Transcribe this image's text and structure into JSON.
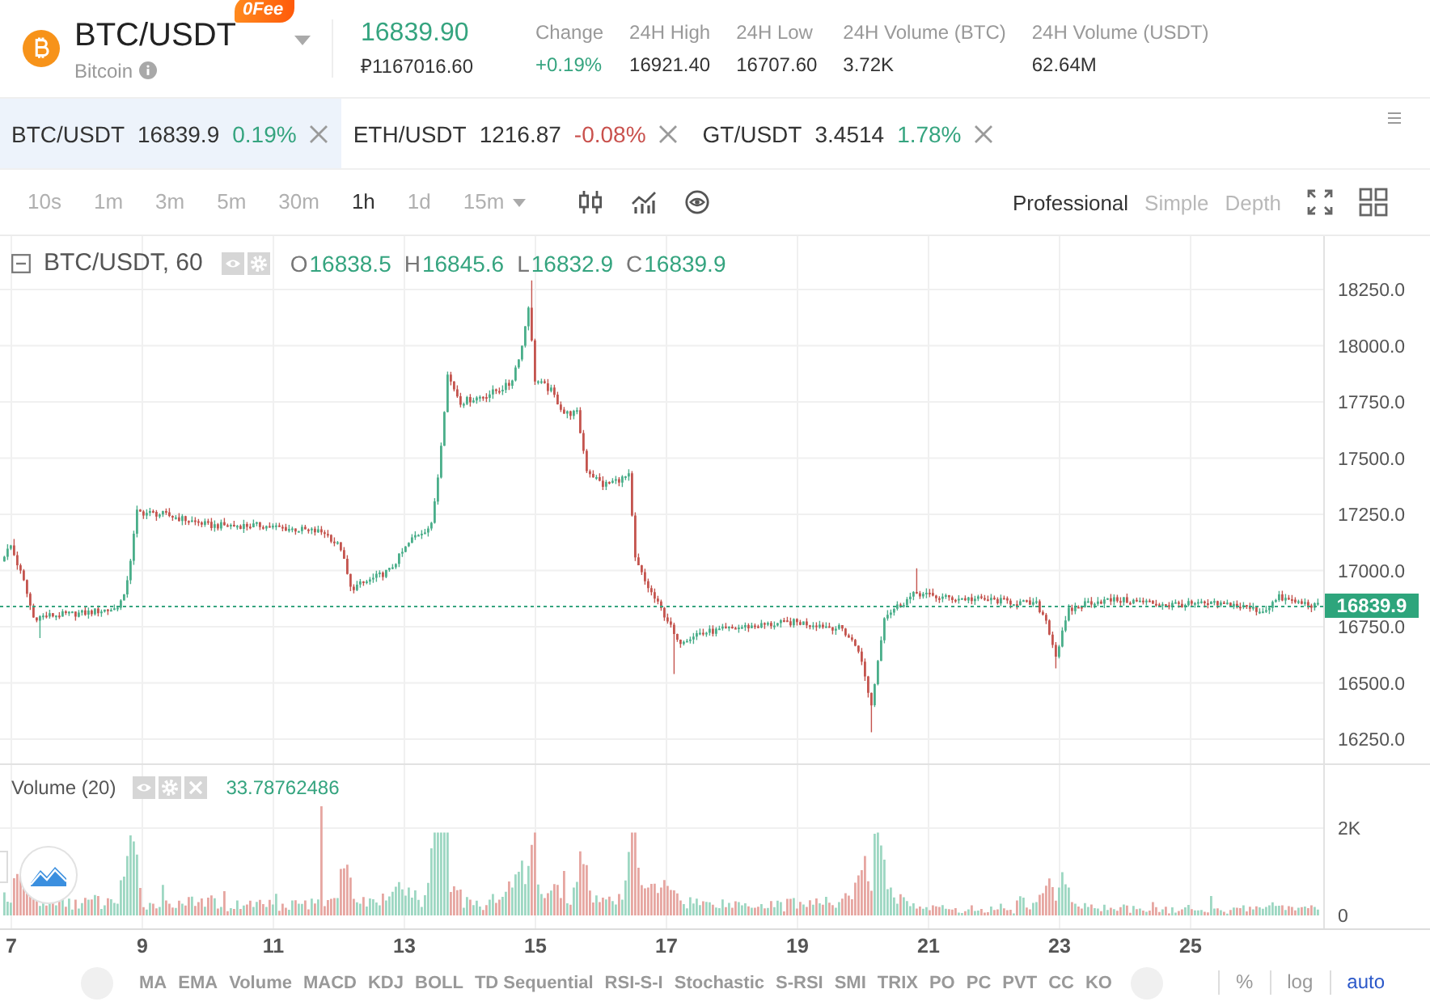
{
  "header": {
    "symbol": "BTC/USDT",
    "badge": "0Fee",
    "coin_name": "Bitcoin",
    "last_price": "16839.90",
    "rising": true,
    "local_price": "₽1167016.60",
    "stats": [
      {
        "label": "Change",
        "value": "+0.19%",
        "rising": true
      },
      {
        "label": "24H High",
        "value": "16921.40"
      },
      {
        "label": "24H Low",
        "value": "16707.60"
      },
      {
        "label": "24H Volume (BTC)",
        "value": "3.72K"
      },
      {
        "label": "24H Volume (USDT)",
        "value": "62.64M"
      }
    ]
  },
  "tabs": [
    {
      "symbol": "BTC/USDT",
      "price": "16839.9",
      "change": "0.19%",
      "rising": true,
      "selected": true
    },
    {
      "symbol": "ETH/USDT",
      "price": "1216.87",
      "change": "-0.08%",
      "rising": false,
      "selected": false
    },
    {
      "symbol": "GT/USDT",
      "price": "3.4514",
      "change": "1.78%",
      "rising": true,
      "selected": false
    }
  ],
  "toolbar": {
    "intervals": [
      {
        "label": "10s",
        "kind": "button",
        "selected": false
      },
      {
        "label": "1m",
        "kind": "button",
        "selected": false
      },
      {
        "label": "3m",
        "kind": "button",
        "selected": false
      },
      {
        "label": "5m",
        "kind": "button",
        "selected": false
      },
      {
        "label": "30m",
        "kind": "button",
        "selected": false
      },
      {
        "label": "1h",
        "kind": "button",
        "selected": true
      },
      {
        "label": "1d",
        "kind": "button",
        "selected": false
      },
      {
        "label": "15m",
        "kind": "dropdown",
        "selected": false
      }
    ],
    "view_modes": [
      {
        "label": "Professional",
        "selected": true
      },
      {
        "label": "Simple",
        "selected": false
      },
      {
        "label": "Depth",
        "selected": false
      }
    ]
  },
  "chart": {
    "legend": {
      "title": "BTC/USDT, 60",
      "ohlc": [
        {
          "key": "O",
          "value": "16838.5"
        },
        {
          "key": "H",
          "value": "16845.6"
        },
        {
          "key": "L",
          "value": "16832.9"
        },
        {
          "key": "C",
          "value": "16839.9"
        }
      ]
    },
    "price_axis": [
      "18250.0",
      "18000.0",
      "17750.0",
      "17500.0",
      "17250.0",
      "17000.0",
      "16750.0",
      "16500.0",
      "16250.0"
    ],
    "last_price": "16839.9"
  },
  "volume": {
    "title": "Volume (20)",
    "value": "33.78762486",
    "axis": [
      "2K",
      "0"
    ]
  },
  "date_axis": [
    "7",
    "9",
    "11",
    "13",
    "15",
    "17",
    "19",
    "21",
    "23",
    "25"
  ],
  "indicators": [
    "MA",
    "EMA",
    "Volume",
    "MACD",
    "KDJ",
    "BOLL",
    "TD Sequential",
    "RSI-S-I",
    "Stochastic",
    "S-RSI",
    "SMI",
    "TRIX",
    "PO",
    "PC",
    "PVT",
    "CC",
    "KO"
  ],
  "scales": [
    {
      "label": "%",
      "selected": false
    },
    {
      "label": "log",
      "selected": false
    },
    {
      "label": "auto",
      "selected": true
    }
  ]
}
